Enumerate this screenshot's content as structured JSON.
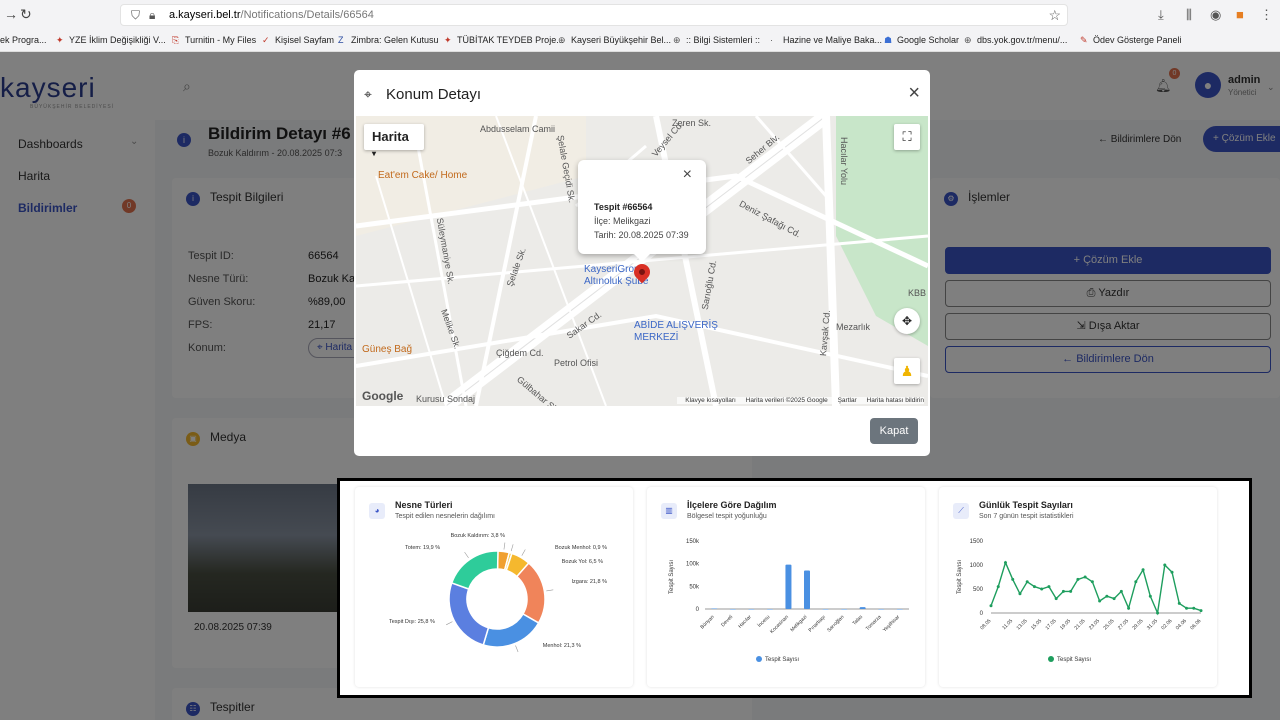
{
  "browser": {
    "url_domain": "a.kayseri.bel.tr",
    "url_path": "/Notifications/Details/66564",
    "bookmarks": [
      {
        "label": "ek Progra..."
      },
      {
        "label": "YZE İklim Değişikliği V..."
      },
      {
        "label": "Turnitin - My Files"
      },
      {
        "label": "Kişisel Sayfam"
      },
      {
        "label": "Zimbra: Gelen Kutusu"
      },
      {
        "label": "TÜBİTAK TEYDEB Proje..."
      },
      {
        "label": "Kayseri Büyükşehir Bel..."
      },
      {
        "label": ":: Bilgi Sistemleri ::"
      },
      {
        "label": "Hazine ve Maliye Baka..."
      },
      {
        "label": "Google Scholar"
      },
      {
        "label": "dbs.yok.gov.tr/menu/..."
      },
      {
        "label": "Ödev Gösterge Paneli"
      }
    ]
  },
  "app": {
    "logo": "kayseri",
    "logo_sub": "BÜYÜKŞEHİR BELEDİYESİ",
    "sidebar": {
      "items": [
        {
          "label": "Dashboards"
        },
        {
          "label": "Harita"
        },
        {
          "label": "Bildirimler",
          "badge": "0"
        }
      ]
    },
    "user": {
      "name": "admin",
      "role": "Yönetici",
      "notif_count": "0"
    },
    "page": {
      "title": "Bildirim Detayı #6",
      "subtitle": "Bozuk Kaldırım - 20.08.2025 07:3",
      "back_label": "Bildirimlere Dön",
      "add_label": "Çözüm Ekle"
    },
    "info": {
      "header": "Tespit Bilgileri",
      "rows": [
        {
          "k": "Tespit ID:",
          "v": "66564"
        },
        {
          "k": "Nesne Türü:",
          "v": "Bozuk Ka"
        },
        {
          "k": "Güven Skoru:",
          "v": "%89,00"
        },
        {
          "k": "FPS:",
          "v": "21,17"
        },
        {
          "k": "Konum:",
          "v": "Harita"
        }
      ]
    },
    "actions": {
      "header": "İşlemler",
      "buttons": [
        "Çözüm Ekle",
        "Yazdır",
        "Dışa Aktar",
        "Bildirimlere Dön"
      ]
    },
    "media": {
      "header": "Medya",
      "date": "20.08.2025 07:39"
    },
    "tespitler": {
      "header": "Tespitler"
    }
  },
  "modal": {
    "title": "Konum Detayı",
    "map_type": "Harita",
    "close_label": "Kapat",
    "info": {
      "title": "Tespit #66564",
      "line1": "İlçe: Melikgazi",
      "line2": "Tarih: 20.08.2025 07:39"
    },
    "labels": [
      {
        "t": "Abdusselam Camii",
        "cls": ""
      },
      {
        "t": "Eat'em Cake/ Home",
        "cls": "poi"
      },
      {
        "t": "KayseriGrou",
        "cls": "blue"
      },
      {
        "t": "Altınoluk Şube",
        "cls": "blue"
      },
      {
        "t": "ABİDE ALIŞVERİŞ",
        "cls": "blue"
      },
      {
        "t": "MERKEZİ",
        "cls": "blue"
      },
      {
        "t": "Petrol Ofisi",
        "cls": ""
      },
      {
        "t": "Güneş Bağ",
        "cls": ""
      },
      {
        "t": "Mezarlık",
        "cls": ""
      },
      {
        "t": "Deniz Şafağı Cd.",
        "cls": ""
      },
      {
        "t": "Seher Blv.",
        "cls": ""
      },
      {
        "t": "Hacılar Yolu",
        "cls": ""
      },
      {
        "t": "Sakar Cd.",
        "cls": ""
      },
      {
        "t": "Çiğdem Cd.",
        "cls": ""
      },
      {
        "t": "Kurusu Sondaj",
        "cls": ""
      },
      {
        "t": "KBB",
        "cls": ""
      },
      {
        "t": "Zeren Sk.",
        "cls": ""
      },
      {
        "t": "Veysel Cd.",
        "cls": ""
      },
      {
        "t": "Şelale Geçidi Sk.",
        "cls": ""
      },
      {
        "t": "Süleymaniye Sk.",
        "cls": ""
      },
      {
        "t": "Şelale Sk.",
        "cls": ""
      },
      {
        "t": "Melike Sk.",
        "cls": ""
      },
      {
        "t": "Sarıoğlu Cd.",
        "cls": ""
      },
      {
        "t": "Kavşak Cd.",
        "cls": ""
      },
      {
        "t": "Gülbahar Sk.",
        "cls": ""
      }
    ],
    "attribution": [
      "Klavye kısayolları",
      "Harita verileri ©2025 Google",
      "Şartlar",
      "Harita hatası bildirin"
    ]
  },
  "charts": {
    "pie": {
      "title": "Nesne Türleri",
      "subtitle": "Tespit edilen nesnelerin dağılımı"
    },
    "bar": {
      "title": "İlçelere Göre Dağılım",
      "subtitle": "Bölgesel tespit yoğunluğu",
      "ylabel": "Tespit Sayısı",
      "legend": "Tespit Sayısı"
    },
    "line": {
      "title": "Günlük Tespit Sayıları",
      "subtitle": "Son 7 günün tespit istatistikleri",
      "ylabel": "Tespit Sayısı",
      "legend": "Tespit Sayısı"
    }
  },
  "chart_data": [
    {
      "type": "pie",
      "title": "Nesne Türleri",
      "categories": [
        "Bozuk Kaldırım",
        "Bozuk Menhol",
        "Bozuk Yol",
        "Izgara",
        "Menhol",
        "Tespit Dışı",
        "Totem"
      ],
      "values": [
        3.8,
        0.9,
        6.5,
        21.8,
        21.3,
        25.8,
        19.9
      ],
      "labels": [
        "Bozuk Kaldırım: 3,8 %",
        "Bozuk Menhol: 0,9 %",
        "Bozuk Yol: 6,5 %",
        "Izgara: 21,8 %",
        "Menhol: 21,3 %",
        "Tespit Dışı: 25,8 %",
        "Totem: 19,9 %"
      ],
      "colors": [
        "#f5b82e",
        "#f08a3c",
        "#f5b82e",
        "#f08a5d",
        "#4a90e2",
        "#5b7fe0",
        "#2ecc9a"
      ]
    },
    {
      "type": "bar",
      "title": "İlçelere Göre Dağılım",
      "categories": [
        "Bünyan",
        "Develi",
        "Hacılar",
        "İncesu",
        "Kocasinan",
        "Melikgazi",
        "Pınarbaşı",
        "Sarıoğlan",
        "Talas",
        "Tomarza",
        "Yeşilhisar"
      ],
      "values": [
        1000,
        0,
        0,
        0,
        98000,
        85000,
        0,
        0,
        4000,
        0,
        0
      ],
      "ylim": [
        0,
        150000
      ],
      "yticks": [
        "0",
        "50k",
        "100k",
        "150k"
      ],
      "ylabel": "Tespit Sayısı",
      "legend": "Tespit Sayısı",
      "color": "#4a90e2"
    },
    {
      "type": "line",
      "title": "Günlük Tespit Sayıları",
      "x": [
        "08.05",
        "09.05",
        "10.05",
        "11.05",
        "12.05",
        "13.05",
        "14.05",
        "15.05",
        "16.05",
        "17.05",
        "18.05",
        "19.05",
        "20.05",
        "21.05",
        "22.05",
        "23.05",
        "24.05",
        "25.05",
        "26.05",
        "27.05",
        "28.05",
        "29.05",
        "30.05",
        "31.05",
        "01.06",
        "02.06",
        "03.06",
        "04.06",
        "05.06",
        "06.06"
      ],
      "xticks": [
        "08.05",
        "11.05",
        "13.05",
        "15.05",
        "17.05",
        "19.05",
        "21.05",
        "23.05",
        "25.05",
        "27.05",
        "29.05",
        "31.05",
        "02.06",
        "04.06",
        "06.06"
      ],
      "values": [
        150,
        550,
        1050,
        700,
        400,
        650,
        550,
        500,
        550,
        300,
        450,
        450,
        700,
        750,
        650,
        250,
        350,
        300,
        450,
        100,
        650,
        900,
        350,
        0,
        1000,
        850,
        200,
        100,
        100,
        50
      ],
      "ylim": [
        0,
        1500
      ],
      "yticks": [
        "0",
        "500",
        "1000",
        "1500"
      ],
      "ylabel": "Tespit Sayısı",
      "legend": "Tespit Sayısı",
      "color": "#1e9e5e"
    }
  ]
}
